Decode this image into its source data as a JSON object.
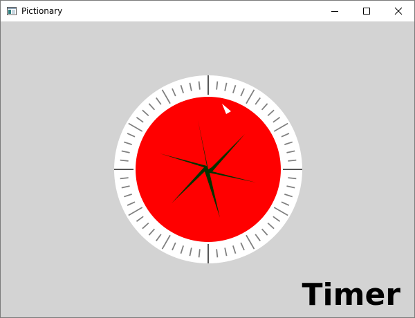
{
  "window": {
    "title": "Pictionary",
    "icons": {
      "app": "app-window-icon",
      "minimize": "minimize-icon",
      "maximize": "maximize-icon",
      "close": "close-icon"
    }
  },
  "timer": {
    "label": "Timer",
    "colors": {
      "background": "#d3d3d3",
      "bezel": "#ffffff",
      "ticks": "#808080",
      "face": "#ff0000",
      "star": "#003300",
      "indicator": "#ffffff"
    },
    "tick_count": 60
  }
}
